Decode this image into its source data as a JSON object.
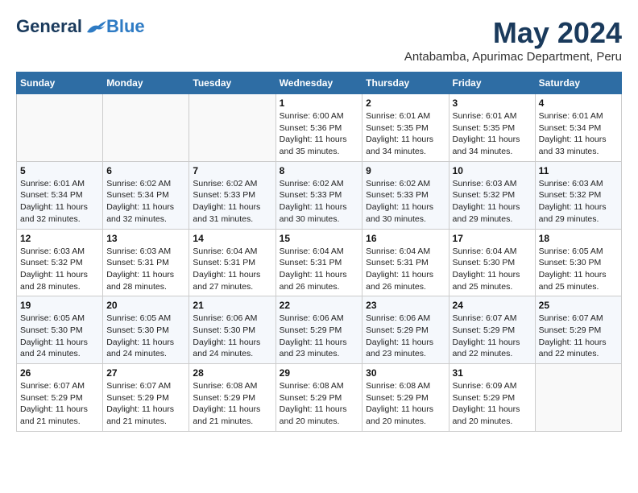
{
  "logo": {
    "general": "General",
    "blue": "Blue"
  },
  "title": {
    "month_year": "May 2024",
    "location": "Antabamba, Apurimac Department, Peru"
  },
  "days_of_week": [
    "Sunday",
    "Monday",
    "Tuesday",
    "Wednesday",
    "Thursday",
    "Friday",
    "Saturday"
  ],
  "weeks": [
    [
      {
        "day": "",
        "sunrise": "",
        "sunset": "",
        "daylight": ""
      },
      {
        "day": "",
        "sunrise": "",
        "sunset": "",
        "daylight": ""
      },
      {
        "day": "",
        "sunrise": "",
        "sunset": "",
        "daylight": ""
      },
      {
        "day": "1",
        "sunrise": "Sunrise: 6:00 AM",
        "sunset": "Sunset: 5:36 PM",
        "daylight": "Daylight: 11 hours and 35 minutes."
      },
      {
        "day": "2",
        "sunrise": "Sunrise: 6:01 AM",
        "sunset": "Sunset: 5:35 PM",
        "daylight": "Daylight: 11 hours and 34 minutes."
      },
      {
        "day": "3",
        "sunrise": "Sunrise: 6:01 AM",
        "sunset": "Sunset: 5:35 PM",
        "daylight": "Daylight: 11 hours and 34 minutes."
      },
      {
        "day": "4",
        "sunrise": "Sunrise: 6:01 AM",
        "sunset": "Sunset: 5:34 PM",
        "daylight": "Daylight: 11 hours and 33 minutes."
      }
    ],
    [
      {
        "day": "5",
        "sunrise": "Sunrise: 6:01 AM",
        "sunset": "Sunset: 5:34 PM",
        "daylight": "Daylight: 11 hours and 32 minutes."
      },
      {
        "day": "6",
        "sunrise": "Sunrise: 6:02 AM",
        "sunset": "Sunset: 5:34 PM",
        "daylight": "Daylight: 11 hours and 32 minutes."
      },
      {
        "day": "7",
        "sunrise": "Sunrise: 6:02 AM",
        "sunset": "Sunset: 5:33 PM",
        "daylight": "Daylight: 11 hours and 31 minutes."
      },
      {
        "day": "8",
        "sunrise": "Sunrise: 6:02 AM",
        "sunset": "Sunset: 5:33 PM",
        "daylight": "Daylight: 11 hours and 30 minutes."
      },
      {
        "day": "9",
        "sunrise": "Sunrise: 6:02 AM",
        "sunset": "Sunset: 5:33 PM",
        "daylight": "Daylight: 11 hours and 30 minutes."
      },
      {
        "day": "10",
        "sunrise": "Sunrise: 6:03 AM",
        "sunset": "Sunset: 5:32 PM",
        "daylight": "Daylight: 11 hours and 29 minutes."
      },
      {
        "day": "11",
        "sunrise": "Sunrise: 6:03 AM",
        "sunset": "Sunset: 5:32 PM",
        "daylight": "Daylight: 11 hours and 29 minutes."
      }
    ],
    [
      {
        "day": "12",
        "sunrise": "Sunrise: 6:03 AM",
        "sunset": "Sunset: 5:32 PM",
        "daylight": "Daylight: 11 hours and 28 minutes."
      },
      {
        "day": "13",
        "sunrise": "Sunrise: 6:03 AM",
        "sunset": "Sunset: 5:31 PM",
        "daylight": "Daylight: 11 hours and 28 minutes."
      },
      {
        "day": "14",
        "sunrise": "Sunrise: 6:04 AM",
        "sunset": "Sunset: 5:31 PM",
        "daylight": "Daylight: 11 hours and 27 minutes."
      },
      {
        "day": "15",
        "sunrise": "Sunrise: 6:04 AM",
        "sunset": "Sunset: 5:31 PM",
        "daylight": "Daylight: 11 hours and 26 minutes."
      },
      {
        "day": "16",
        "sunrise": "Sunrise: 6:04 AM",
        "sunset": "Sunset: 5:31 PM",
        "daylight": "Daylight: 11 hours and 26 minutes."
      },
      {
        "day": "17",
        "sunrise": "Sunrise: 6:04 AM",
        "sunset": "Sunset: 5:30 PM",
        "daylight": "Daylight: 11 hours and 25 minutes."
      },
      {
        "day": "18",
        "sunrise": "Sunrise: 6:05 AM",
        "sunset": "Sunset: 5:30 PM",
        "daylight": "Daylight: 11 hours and 25 minutes."
      }
    ],
    [
      {
        "day": "19",
        "sunrise": "Sunrise: 6:05 AM",
        "sunset": "Sunset: 5:30 PM",
        "daylight": "Daylight: 11 hours and 24 minutes."
      },
      {
        "day": "20",
        "sunrise": "Sunrise: 6:05 AM",
        "sunset": "Sunset: 5:30 PM",
        "daylight": "Daylight: 11 hours and 24 minutes."
      },
      {
        "day": "21",
        "sunrise": "Sunrise: 6:06 AM",
        "sunset": "Sunset: 5:30 PM",
        "daylight": "Daylight: 11 hours and 24 minutes."
      },
      {
        "day": "22",
        "sunrise": "Sunrise: 6:06 AM",
        "sunset": "Sunset: 5:29 PM",
        "daylight": "Daylight: 11 hours and 23 minutes."
      },
      {
        "day": "23",
        "sunrise": "Sunrise: 6:06 AM",
        "sunset": "Sunset: 5:29 PM",
        "daylight": "Daylight: 11 hours and 23 minutes."
      },
      {
        "day": "24",
        "sunrise": "Sunrise: 6:07 AM",
        "sunset": "Sunset: 5:29 PM",
        "daylight": "Daylight: 11 hours and 22 minutes."
      },
      {
        "day": "25",
        "sunrise": "Sunrise: 6:07 AM",
        "sunset": "Sunset: 5:29 PM",
        "daylight": "Daylight: 11 hours and 22 minutes."
      }
    ],
    [
      {
        "day": "26",
        "sunrise": "Sunrise: 6:07 AM",
        "sunset": "Sunset: 5:29 PM",
        "daylight": "Daylight: 11 hours and 21 minutes."
      },
      {
        "day": "27",
        "sunrise": "Sunrise: 6:07 AM",
        "sunset": "Sunset: 5:29 PM",
        "daylight": "Daylight: 11 hours and 21 minutes."
      },
      {
        "day": "28",
        "sunrise": "Sunrise: 6:08 AM",
        "sunset": "Sunset: 5:29 PM",
        "daylight": "Daylight: 11 hours and 21 minutes."
      },
      {
        "day": "29",
        "sunrise": "Sunrise: 6:08 AM",
        "sunset": "Sunset: 5:29 PM",
        "daylight": "Daylight: 11 hours and 20 minutes."
      },
      {
        "day": "30",
        "sunrise": "Sunrise: 6:08 AM",
        "sunset": "Sunset: 5:29 PM",
        "daylight": "Daylight: 11 hours and 20 minutes."
      },
      {
        "day": "31",
        "sunrise": "Sunrise: 6:09 AM",
        "sunset": "Sunset: 5:29 PM",
        "daylight": "Daylight: 11 hours and 20 minutes."
      },
      {
        "day": "",
        "sunrise": "",
        "sunset": "",
        "daylight": ""
      }
    ]
  ]
}
